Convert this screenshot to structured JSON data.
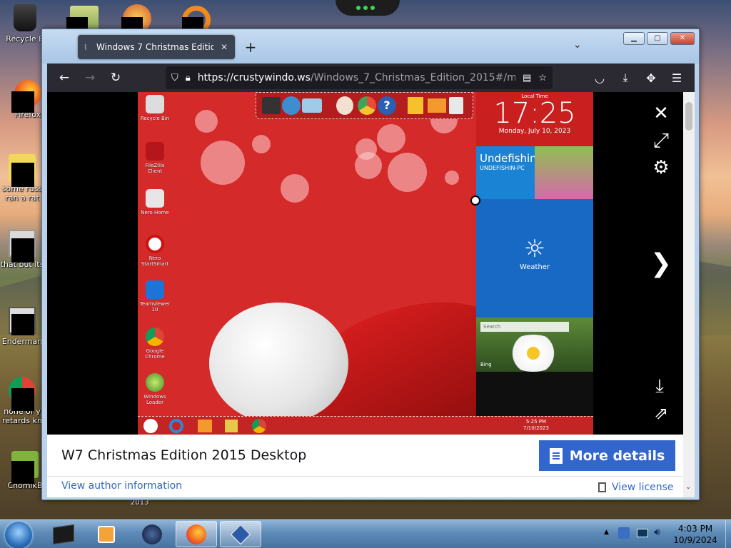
{
  "desktop": {
    "icons": [
      {
        "label": "Recycle B",
        "name": "recycle-bin"
      },
      {
        "label": "Firefox",
        "name": "firefox"
      },
      {
        "label": "some russ ran a rat",
        "name": "file-some-russ"
      },
      {
        "label": "that but its",
        "name": "file-that-but-its"
      },
      {
        "label": "Enderman",
        "name": "enderman"
      },
      {
        "label": "none of y retards kn",
        "name": "file-none-of-y"
      },
      {
        "label": "ChomikB",
        "name": "chomikbox"
      }
    ],
    "below_window_text": "2013"
  },
  "window": {
    "tab_title": "Windows 7 Christmas Edition 2015",
    "tab_close": "✕",
    "new_tab": "+",
    "list_tabs": "⌄",
    "controls": {
      "minimize": "▁",
      "maximize": "▢",
      "close": "✕"
    }
  },
  "navbar": {
    "url_host": "https://crustywindo.ws",
    "url_rest": "/Windows_7_Christmas_Edition_2015#/media",
    "back": "←",
    "forward": "→",
    "reload": "↻"
  },
  "viewer": {
    "close": "✕",
    "expand": "⤢",
    "settings": "⚙",
    "next": "❯",
    "download": "⤓",
    "share": "⇗"
  },
  "screenshot": {
    "icons": [
      "Recycle Bin",
      "FileZilla Client",
      "Nero Home",
      "Nero StartSmart",
      "TeamViewer 10",
      "Google Chrome",
      "Windows Loader"
    ],
    "local_time_label": "Local Time",
    "time": "17:25",
    "date": "Monday, July 10, 2023",
    "user": "Undefishin",
    "pc": "UNDEFISHIN-PC",
    "weather": "Weather",
    "search": "Search",
    "bing": "Bing",
    "tray_time": "5:25 PM",
    "tray_date": "7/10/2023"
  },
  "page": {
    "caption": "W7 Christmas Edition 2015 Desktop",
    "more_details": "More details",
    "author_link": "View author information",
    "license_link": "View license"
  },
  "taskbar": {
    "time": "4:03 PM",
    "date": "10/9/2024",
    "apps": [
      "start",
      "terminal",
      "media-player",
      "settings-orb",
      "firefox",
      "virtualbox"
    ]
  },
  "colors": {
    "accent": "#3366cc",
    "firefox_toolbar": "#2b2a33",
    "xmas_red": "#d42a2a"
  }
}
